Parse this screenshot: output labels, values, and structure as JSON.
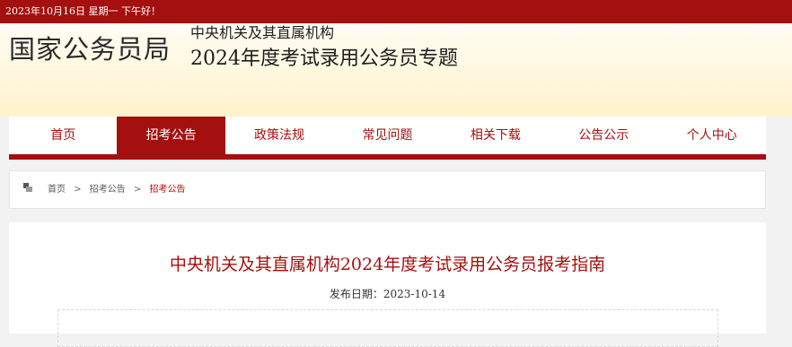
{
  "topbar": {
    "text": "2023年10月16日  星期一  下午好！"
  },
  "banner": {
    "logo": "国家公务员局",
    "subtitle_line1": "中央机关及其直属机构",
    "subtitle_line2": "2024年度考试录用公务员专题"
  },
  "nav": {
    "items": [
      {
        "label": "首页"
      },
      {
        "label": "招考公告",
        "active": true
      },
      {
        "label": "政策法规"
      },
      {
        "label": "常见问题"
      },
      {
        "label": "相关下载"
      },
      {
        "label": "公告公示"
      },
      {
        "label": "个人中心"
      }
    ]
  },
  "breadcrumb": {
    "home": "首页",
    "sep": ">",
    "section": "招考公告",
    "current": "招考公告"
  },
  "article": {
    "title": "中央机关及其直属机构2024年度考试录用公务员报考指南",
    "date_label": "发布日期：2023-10-14"
  },
  "colors": {
    "brand_red": "#a4100f",
    "crumb_current": "#c00000",
    "banner_bg": "#fff3cc"
  }
}
